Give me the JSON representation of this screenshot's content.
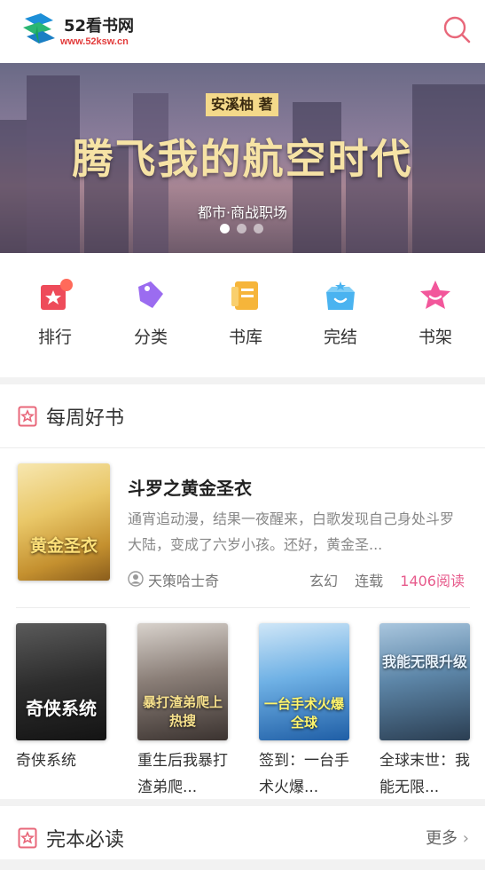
{
  "header": {
    "logo_title": "52看书网",
    "logo_url": "www.52ksw.cn"
  },
  "banner": {
    "author": "安溪柚 著",
    "title": "腾飞我的航空时代",
    "subtitle": "都市·商战职场"
  },
  "nav": [
    {
      "label": "排行",
      "icon": "ranking-icon",
      "color": "#ee4b5a"
    },
    {
      "label": "分类",
      "icon": "category-tag-icon",
      "color": "#9b6cf0"
    },
    {
      "label": "书库",
      "icon": "library-icon",
      "color": "#f6b53a"
    },
    {
      "label": "完结",
      "icon": "completed-box-icon",
      "color": "#4ab3f0"
    },
    {
      "label": "书架",
      "icon": "bookshelf-icon",
      "color": "#f2579b"
    }
  ],
  "weekly": {
    "title": "每周好书",
    "featured": {
      "title": "斗罗之黄金圣衣",
      "description": "通宵追动漫，结果一夜醒来，白歌发现自己身处斗罗大陆，变成了六岁小孩。还好，黄金圣...",
      "author": "天策哈士奇",
      "genre": "玄幻",
      "status": "连载",
      "reads": "1406阅读",
      "cover_text": "黄金圣衣"
    },
    "books": [
      {
        "title": "奇侠系统",
        "cover_text": "奇侠系统"
      },
      {
        "title": "重生后我暴打渣弟爬...",
        "cover_text": "暴打渣弟爬上热搜"
      },
      {
        "title": "签到：一台手术火爆...",
        "cover_text": "一台手术火爆全球"
      },
      {
        "title": "全球末世：我能无限...",
        "cover_text": "我能无限升级"
      }
    ]
  },
  "complete": {
    "title": "完本必读",
    "more": "更多"
  },
  "colors": {
    "accent_pink": "#e75b8c",
    "search_icon": "#e8677a",
    "logo_green": "#2bb673",
    "logo_blue": "#1d8fd8"
  }
}
